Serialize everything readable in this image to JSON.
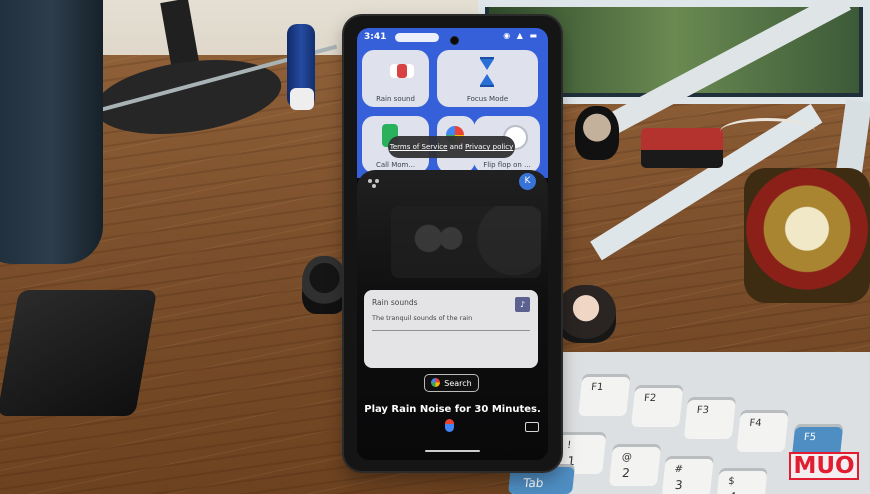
{
  "watermark": "MUO",
  "phone": {
    "status_time": "3:41",
    "tiles": [
      {
        "label": "Rain sound"
      },
      {
        "label": "Focus Mode"
      },
      {
        "label": "Call Mom..."
      },
      {
        "label": "Flip flop on ..."
      }
    ],
    "terms_text_a": "Terms of Service",
    "terms_text_b": "and",
    "terms_text_c": "Privacy policy",
    "avatar_initial": "K",
    "card": {
      "title": "Rain sounds",
      "description": "The tranquil sounds of the rain",
      "icon": "music-note-icon"
    },
    "search_label": "Search",
    "query_text": "Play Rain Noise for 30 Minutes."
  },
  "keyboard": {
    "keys": [
      {
        "main": "",
        "sub": "F1"
      },
      {
        "main": "",
        "sub": "F2"
      },
      {
        "main": "",
        "sub": "F3"
      },
      {
        "main": "",
        "sub": "F4"
      },
      {
        "main": "",
        "sub": "F5"
      },
      {
        "main": "1",
        "sub": "!"
      },
      {
        "main": "2",
        "sub": "@"
      },
      {
        "main": "3",
        "sub": "#"
      },
      {
        "main": "4",
        "sub": "$"
      },
      {
        "main": "",
        "sub": "Tab"
      }
    ]
  }
}
